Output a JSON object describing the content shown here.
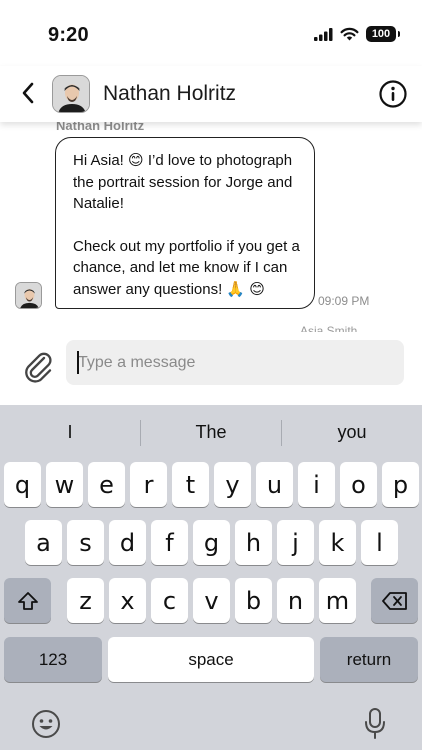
{
  "status_bar": {
    "time": "9:20",
    "battery": "100",
    "icons": [
      "signal-icon",
      "wifi-icon",
      "battery-icon"
    ]
  },
  "header": {
    "contact_name": "Nathan Holritz",
    "back_icon": "chevron-left-icon",
    "info_icon": "info-icon"
  },
  "chat": {
    "sender_name": "Nathan Holritz",
    "message_paragraph_1": "Hi Asia! 😊 I’d love to photograph the portrait session for Jorge and Natalie!",
    "message_paragraph_2": "Check out my portfolio if you get a chance, and let me know if I can answer any questions! 🙏 😊",
    "timestamp": "09:09 PM",
    "next_sender_partial": "Asia Smith"
  },
  "composer": {
    "placeholder": "Type a message",
    "value": "",
    "attach_icon": "paperclip-icon"
  },
  "keyboard": {
    "suggestions": [
      "I",
      "The",
      "you"
    ],
    "row1": [
      "q",
      "w",
      "e",
      "r",
      "t",
      "y",
      "u",
      "i",
      "o",
      "p"
    ],
    "row2": [
      "a",
      "s",
      "d",
      "f",
      "g",
      "h",
      "j",
      "k",
      "l"
    ],
    "row3": [
      "z",
      "x",
      "c",
      "v",
      "b",
      "n",
      "m"
    ],
    "numbers_key": "123",
    "space_key": "space",
    "return_key": "return",
    "shift_icon": "shift-icon",
    "delete_icon": "backspace-icon",
    "emoji_icon": "emoji-icon",
    "mic_icon": "microphone-icon"
  }
}
